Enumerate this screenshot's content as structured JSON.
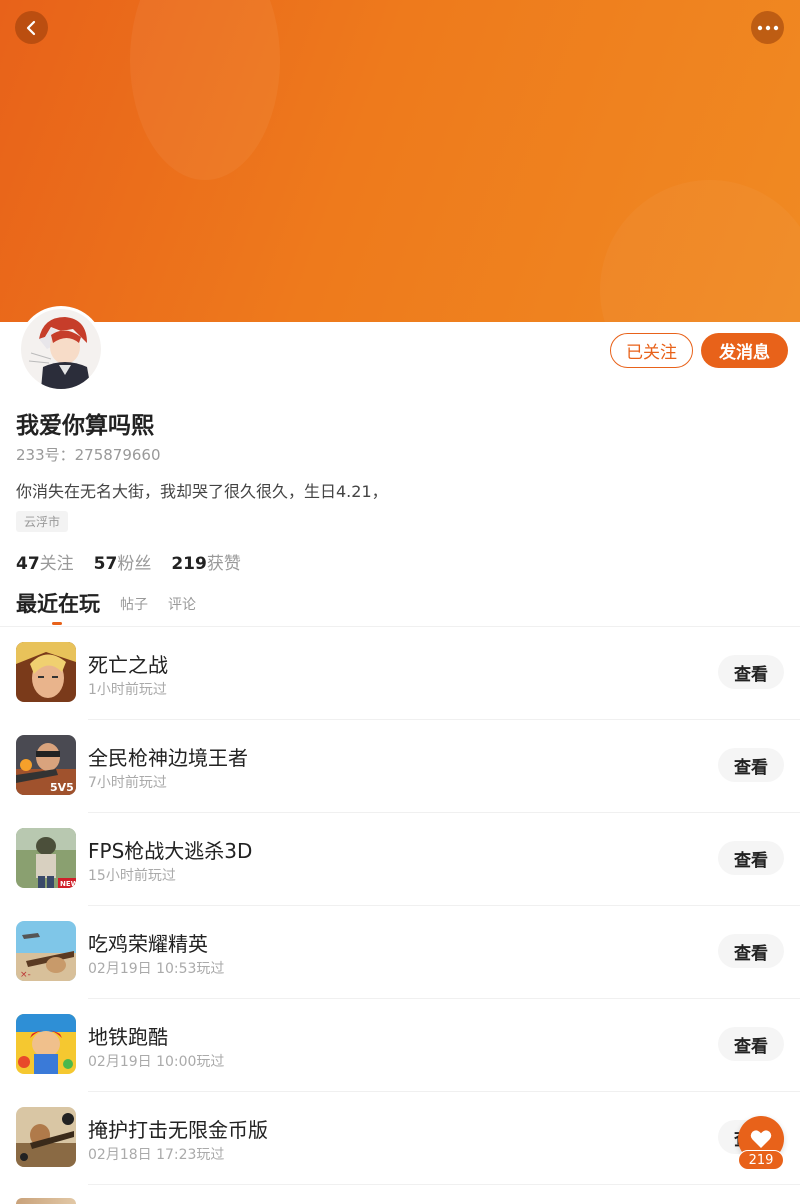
{
  "profile": {
    "username": "我爱你算吗熙",
    "uid": "233号：275879660",
    "bio": "你消失在无名大街，我却哭了很久很久，生日4.21，",
    "location": "云浮市",
    "follow_button": "已关注",
    "message_button": "发消息",
    "avatar_icon": "anime-avatar"
  },
  "stats": [
    {
      "num": "47",
      "label": "关注"
    },
    {
      "num": "57",
      "label": "粉丝"
    },
    {
      "num": "219",
      "label": "获赞"
    }
  ],
  "tabs": [
    {
      "label": "最近在玩",
      "active": true
    },
    {
      "label": "帖子",
      "active": false
    },
    {
      "label": "评论",
      "active": false
    }
  ],
  "games": [
    {
      "title": "死亡之战",
      "time": "1小时前玩过",
      "action": "查看",
      "icon": "hero-face-icon"
    },
    {
      "title": "全民枪神边境王者",
      "time": "7小时前玩过",
      "action": "查看",
      "icon": "shooter-icon"
    },
    {
      "title": "FPS枪战大逃杀3D",
      "time": "15小时前玩过",
      "action": "查看",
      "icon": "soldier-icon"
    },
    {
      "title": "吃鸡荣耀精英",
      "time": "02月19日 10:53玩过",
      "action": "查看",
      "icon": "sniper-icon"
    },
    {
      "title": "地铁跑酷",
      "time": "02月19日 10:00玩过",
      "action": "查看",
      "icon": "subway-runner-icon"
    },
    {
      "title": "掩护打击无限金币版",
      "time": "02月18日 17:23玩过",
      "action": "查看",
      "icon": "cover-strike-icon"
    }
  ],
  "like": {
    "count": "219",
    "icon": "heart-icon"
  },
  "colors": {
    "accent": "#e8621a",
    "banner_start": "#e8621a",
    "banner_end": "#f08a22"
  }
}
